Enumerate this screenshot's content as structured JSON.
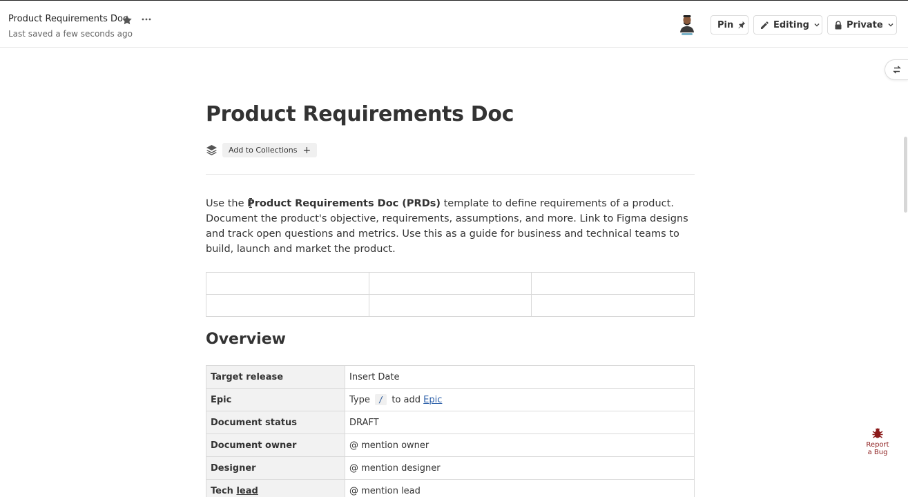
{
  "header": {
    "doc_title": "Product Requirements Doc",
    "saved_status": "Last saved a few seconds ago",
    "pin_label": "Pin",
    "editing_label": "Editing",
    "private_label": "Private"
  },
  "page": {
    "title": "Product Requirements Doc",
    "add_collections_label": "Add to Collections",
    "intro": {
      "prefix": "Use the ",
      "bold": "Product Requirements Doc (PRDs)",
      "suffix": " template to define requirements of a product. Document the product's objective, requirements, assumptions, and more. Link to Figma designs and track open questions and metrics. Use this as a guide for business and technical teams to build, launch and market the product."
    },
    "overview_heading": "Overview",
    "overview_rows": [
      {
        "key": "Target release",
        "value": "Insert Date"
      },
      {
        "key": "Epic",
        "value_prefix": "Type",
        "value_code": "/",
        "value_mid": "to add",
        "value_link": "Epic"
      },
      {
        "key": "Document status",
        "value": "DRAFT"
      },
      {
        "key": "Document owner",
        "value": "@ mention owner"
      },
      {
        "key": "Designer",
        "value": "@ mention designer"
      },
      {
        "key_prefix": "Tech",
        "key_link": "lead",
        "value": "@ mention lead"
      }
    ]
  },
  "report_bug": {
    "line1": "Report",
    "line2": "a Bug"
  },
  "colors": {
    "bug_red": "#8b1a1a",
    "link_blue": "#2a5ea8",
    "avatar_underline": "#7ab3c9"
  },
  "icons": [
    "star-icon",
    "more-icon",
    "pin-icon",
    "pencil-icon",
    "chevron-down-icon",
    "lock-icon",
    "swap-icon",
    "layers-icon",
    "plus-icon",
    "bug-icon"
  ]
}
